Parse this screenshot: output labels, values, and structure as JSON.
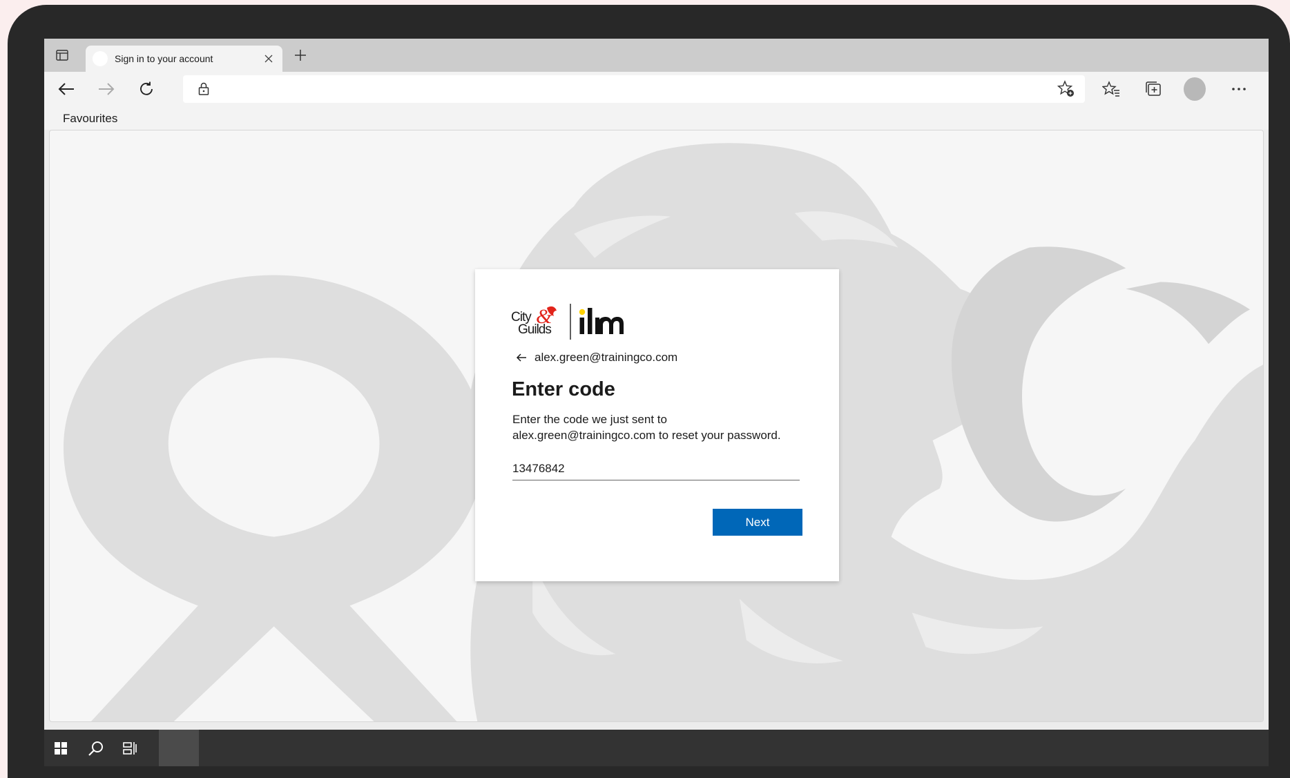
{
  "browser": {
    "tab": {
      "title": "Sign in to your account",
      "favicon": "site-favicon"
    },
    "toolbar": {
      "address_value": "",
      "icons": [
        "back-arrow-icon",
        "forward-arrow-icon",
        "refresh-icon",
        "lock-icon",
        "add-favourite-icon",
        "favourites-icon",
        "collections-icon",
        "profile-avatar",
        "more-icon"
      ]
    },
    "favourites_bar": {
      "label": "Favourites"
    }
  },
  "signin": {
    "logo": {
      "left_text": "City & Guilds",
      "right_text": "ilm"
    },
    "identity": "alex.green@trainingco.com",
    "title": "Enter code",
    "description": "Enter the code we just sent to alex.green@trainingco.com to reset your password.",
    "code_value": "13476842",
    "next_label": "Next",
    "colors": {
      "button": "#0067b8",
      "logo_red": "#e2231a",
      "logo_yellow": "#ffd200"
    }
  },
  "taskbar": {
    "icons": [
      "windows-start-icon",
      "search-icon",
      "task-view-icon",
      "active-app"
    ]
  }
}
